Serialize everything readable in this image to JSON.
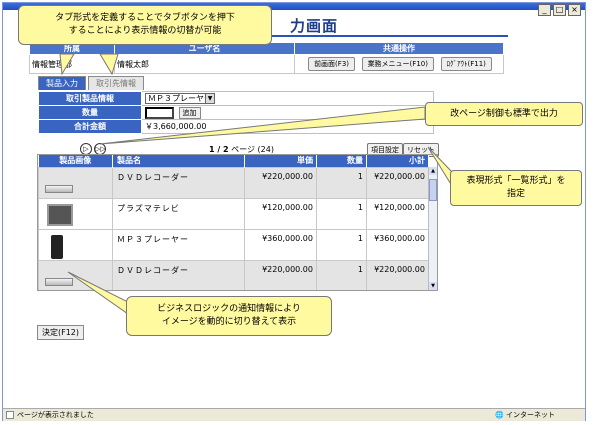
{
  "page": {
    "title_visible": "力画面",
    "window_buttons": [
      "_",
      "□",
      "×"
    ]
  },
  "header_table": {
    "headers": [
      "所属",
      "ユーザ名",
      "共通操作"
    ],
    "affiliation": "情報管理部",
    "user_name": "情報太郎",
    "buttons": [
      "前画面(F3)",
      "業務メニュー(F10)",
      "ﾛｸﾞｱｳﾄ(F11)"
    ]
  },
  "tabs": [
    {
      "label": "製品入力",
      "active": true
    },
    {
      "label": "取引先情報",
      "active": false
    }
  ],
  "form": {
    "product_label": "取引製品情報",
    "product_value": "ＭＰ３プレーヤー",
    "qty_label": "数量",
    "add_button": "追加",
    "total_label": "合計金額",
    "total_value": "￥3,660,000.00"
  },
  "paging": {
    "page_text": "1 / 2",
    "page_unit": "ページ (24)",
    "item_settings": "項目設定",
    "reset": "リセット"
  },
  "list": {
    "columns": [
      "製品画像",
      "製品名",
      "単価",
      "数量",
      "小計"
    ],
    "rows": [
      {
        "image": "dvd-image",
        "name": "ＤＶＤレコーダー",
        "price": "¥220,000.00",
        "qty": "1",
        "subtotal": "¥220,000.00"
      },
      {
        "image": "tv-image",
        "name": "プラズマテレビ",
        "price": "¥120,000.00",
        "qty": "1",
        "subtotal": "¥120,000.00"
      },
      {
        "image": "mp3-image",
        "name": "ＭＰ３プレーヤー",
        "price": "¥360,000.00",
        "qty": "1",
        "subtotal": "¥360,000.00"
      },
      {
        "image": "dvd-image",
        "name": "ＤＶＤレコーダー",
        "price": "¥220,000.00",
        "qty": "1",
        "subtotal": "¥220,000.00"
      }
    ]
  },
  "decide_button": "決定(F12)",
  "statusbar": {
    "left": "ページが表示されました",
    "zone": "インターネット"
  },
  "callouts": {
    "tab_line1": "タブ形式を定義することでタブボタンを押下",
    "tab_line2": "することにより表示情報の切替が可能",
    "paging": "改ページ制御も標準で出力",
    "list_line1": "表現形式「一覧形式」を",
    "list_line2": "指定",
    "biz_line1": "ビジネスロジックの通知情報により",
    "biz_line2": "イメージを動的に切り替えて表示"
  },
  "colors": {
    "header_blue": "#4a74c9",
    "callout_yellow": "#fffaa0"
  }
}
